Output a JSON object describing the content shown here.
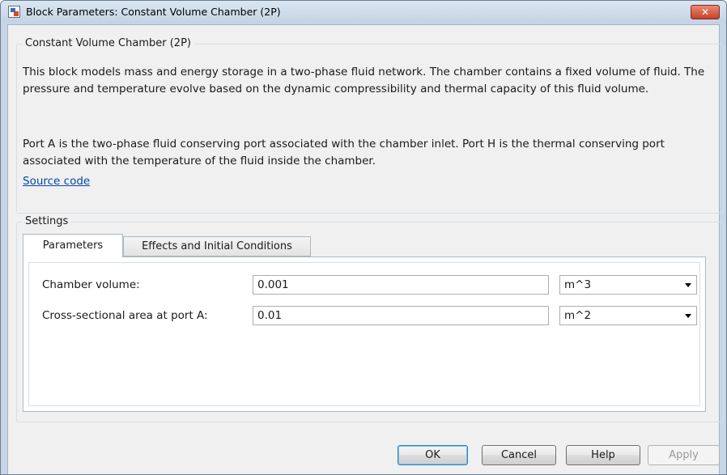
{
  "window": {
    "title": "Block Parameters: Constant Volume Chamber (2P)",
    "close_label": "✕"
  },
  "block": {
    "name": "Constant Volume Chamber (2P)",
    "description_1": "This block models mass and energy storage in a two-phase fluid network. The chamber contains a fixed volume of fluid. The pressure and temperature evolve based on the dynamic compressibility and thermal capacity of this fluid volume.",
    "description_2": "Port A is the two-phase fluid conserving port associated with the chamber inlet. Port H is the thermal conserving port associated with the temperature of the fluid inside the chamber.",
    "source_link": "Source code"
  },
  "settings": {
    "title": "Settings",
    "tabs": [
      {
        "label": "Parameters",
        "active": true
      },
      {
        "label": "Effects and Initial Conditions",
        "active": false
      }
    ],
    "params": [
      {
        "label": "Chamber volume:",
        "value": "0.001",
        "unit": "m^3"
      },
      {
        "label": "Cross-sectional area at port A:",
        "value": "0.01",
        "unit": "m^2"
      }
    ]
  },
  "buttons": {
    "ok": "OK",
    "cancel": "Cancel",
    "help": "Help",
    "apply": "Apply"
  },
  "colors": {
    "link": "#0645ad",
    "close_button": "#c7412a",
    "title_bar": "#c7d6e6"
  }
}
